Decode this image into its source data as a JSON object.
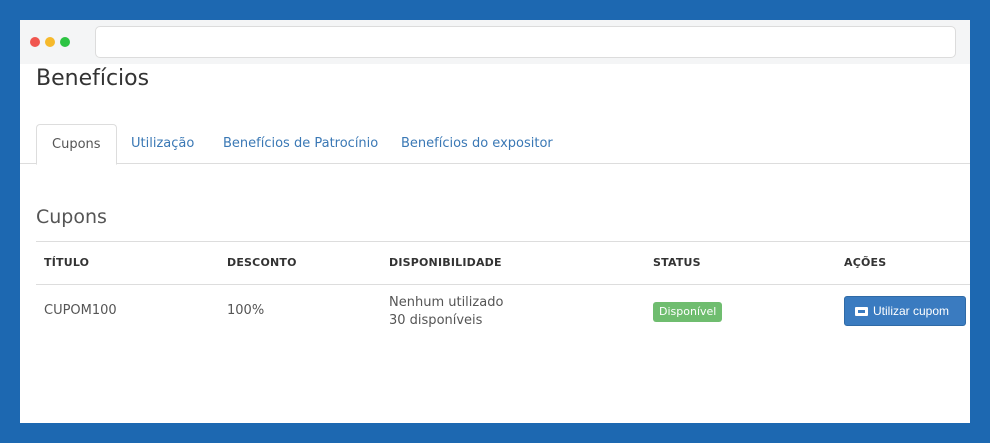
{
  "page": {
    "title": "Benefícios",
    "section_title": "Cupons"
  },
  "tabs": [
    {
      "label": "Cupons",
      "active": true
    },
    {
      "label": "Utilização",
      "active": false
    },
    {
      "label": "Benefícios de Patrocínio",
      "active": false
    },
    {
      "label": "Benefícios do expositor",
      "active": false
    }
  ],
  "table": {
    "headers": {
      "titulo": "TÍTULO",
      "desconto": "DESCONTO",
      "disponibilidade": "DISPONIBILIDADE",
      "status": "STATUS",
      "acoes": "AÇÕES"
    },
    "rows": [
      {
        "titulo": "CUPOM100",
        "desconto": "100%",
        "disponibilidade_line1": "Nenhum utilizado",
        "disponibilidade_line2": "30 disponíveis",
        "status": "Disponível",
        "action_label": "Utilizar cupom"
      }
    ]
  },
  "colors": {
    "background": "#1d68b1",
    "link": "#3a78b5",
    "badge_success": "#6fbd6f",
    "button_primary": "#3a7bc0"
  },
  "icons": {
    "window_controls": [
      "close-dot",
      "minimize-dot",
      "maximize-dot"
    ],
    "action_button": "ticket-icon"
  }
}
